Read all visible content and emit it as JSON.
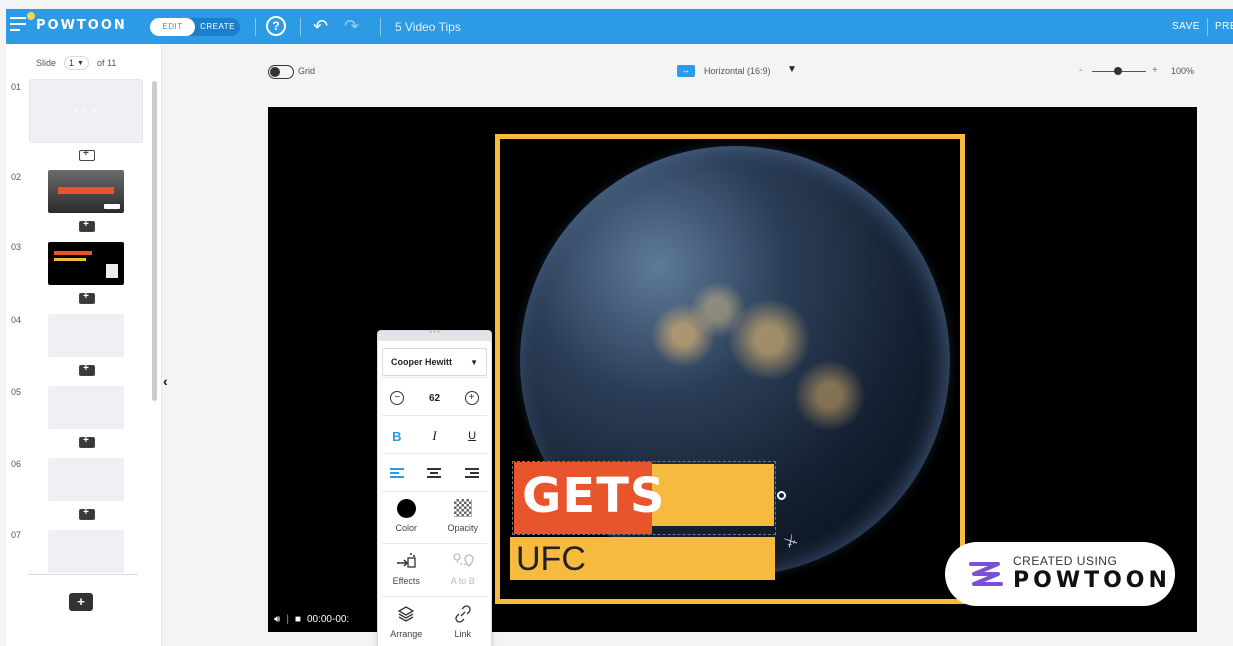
{
  "app": {
    "brand": "POWTOON",
    "project_title": "5 Video Tips"
  },
  "topbar": {
    "mode_edit": "EDIT",
    "mode_create": "CREATE",
    "help_label": "?",
    "save_label": "SAVE",
    "preview_label": "PRE"
  },
  "slides_panel": {
    "slide_label": "Slide",
    "current_slide": "1",
    "total_label": "of 11",
    "slides": [
      {
        "number": "01",
        "has_content": false
      },
      {
        "number": "02",
        "has_content": true
      },
      {
        "number": "03",
        "has_content": true
      },
      {
        "number": "04",
        "has_content": false
      },
      {
        "number": "05",
        "has_content": false
      },
      {
        "number": "06",
        "has_content": false
      },
      {
        "number": "07",
        "has_content": false
      }
    ],
    "add_label": "+"
  },
  "canvas_toolbar": {
    "grid_label": "Grid",
    "grid_on": false,
    "orientation_label": "Horizontal (16:9)",
    "zoom_value": "100%",
    "zoom_minus": "-",
    "zoom_plus": "+"
  },
  "stage": {
    "headline": "GETS",
    "subline": "UFC",
    "badge_top": "CREATED USING",
    "badge_brand": "POWTOON",
    "player_time": "00:00-00:"
  },
  "text_panel": {
    "font_family": "Cooper Hewitt",
    "font_size": "62",
    "bold_label": "B",
    "italic_label": "I",
    "underline_label": "U",
    "color_label": "Color",
    "opacity_label": "Opacity",
    "effects_label": "Effects",
    "a_to_b_label": "A to B",
    "arrange_label": "Arrange",
    "link_label": "Link"
  },
  "colors": {
    "brand_blue": "#2c9ae5",
    "accent_yellow": "#f6bb3e",
    "accent_orange": "#e8542c"
  }
}
